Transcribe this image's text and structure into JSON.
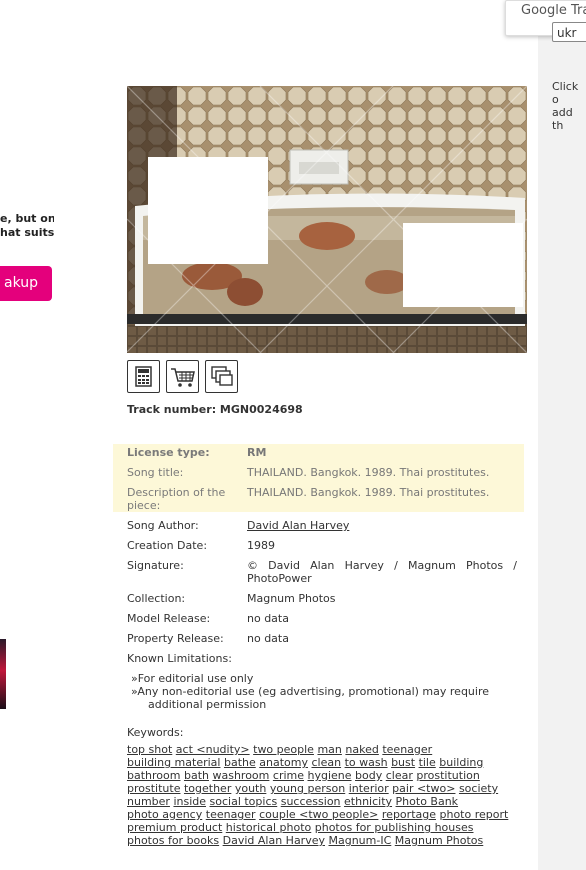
{
  "translate": {
    "brand": "Google Trans",
    "select_value": "ukr"
  },
  "hint": {
    "line1": "Click o",
    "line2": "add th"
  },
  "promo": {
    "line1": "e, but on",
    "line2": "hat suits",
    "button": "akup"
  },
  "actions": {
    "calculate": "calculator-icon",
    "cart": "cart-icon",
    "similar": "similar-icon"
  },
  "track": "Track number: MGN0024698",
  "details": {
    "license": {
      "label": "License type:",
      "value": "RM"
    },
    "song_title": {
      "label": "Song title:",
      "value": "THAILAND. Bangkok. 1989. Thai prostitutes."
    },
    "description": {
      "label": "Description of the piece:",
      "value": "THAILAND. Bangkok. 1989. Thai prostitutes."
    },
    "author": {
      "label": "Song Author:",
      "value": "David Alan Harvey"
    },
    "creation": {
      "label": "Creation Date:",
      "value": "1989"
    },
    "signature": {
      "label": "Signature:",
      "value": "© David Alan Harvey / Magnum Photos / PhotoPower"
    },
    "collection": {
      "label": "Collection:",
      "value": "Magnum Photos"
    },
    "model_release": {
      "label": "Model Release:",
      "value": "no data"
    },
    "property_release": {
      "label": "Property Release:",
      "value": "no data"
    },
    "limitations": {
      "label": "Known Limitations:"
    }
  },
  "limitations": [
    "»For editorial use only",
    "»Any non-editorial use (eg advertising, promotional) may require",
    "additional permission"
  ],
  "keywords_label": "Keywords:",
  "keywords": [
    "top shot",
    "act <nudity>",
    "two people",
    "man",
    "naked",
    "teenager",
    "building material",
    "bathe",
    "anatomy",
    "clean",
    "to wash",
    "bust",
    "tile",
    "building",
    "bathroom",
    "bath",
    "washroom",
    "crime",
    "hygiene",
    "body",
    "clear",
    "prostitution",
    "prostitute",
    "together",
    "youth",
    "young person",
    "interior",
    "pair <two>",
    "society",
    "number",
    "inside",
    "social topics",
    "succession",
    "ethnicity",
    "Photo Bank",
    "photo agency",
    "teenager",
    "couple <two people>",
    "reportage",
    "photo report",
    "premium product",
    "historical photo",
    "photos for publishing houses",
    "photos for books",
    "David Alan Harvey",
    "Magnum-IC",
    "Magnum Photos"
  ],
  "colors": {
    "accent": "#e4007c",
    "highlight": "#fdf8d8"
  }
}
